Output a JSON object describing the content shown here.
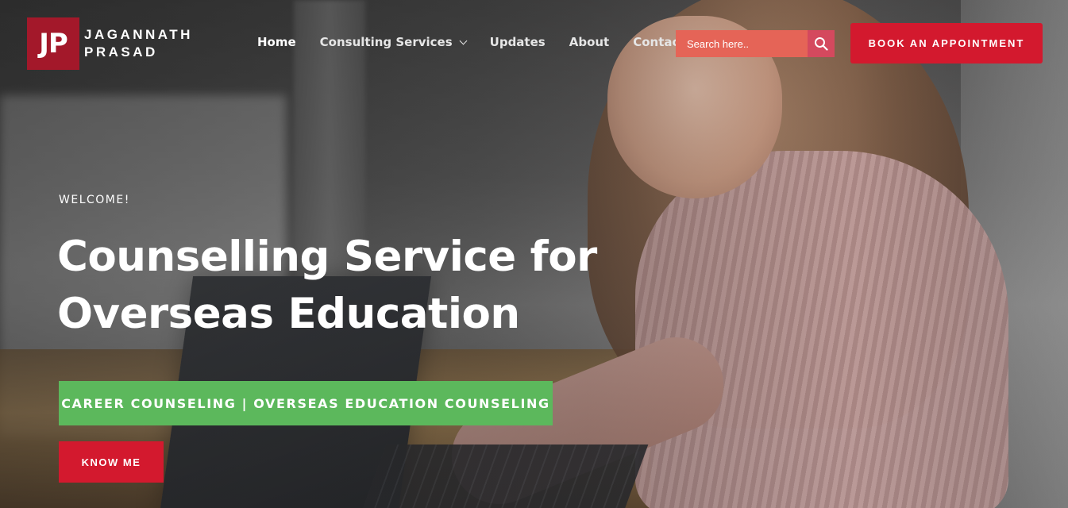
{
  "logo": {
    "mark": "JP",
    "line1": "JAGANNATH",
    "line2": "PRASAD"
  },
  "nav": {
    "items": [
      {
        "label": "Home",
        "active": true
      },
      {
        "label": "Consulting Services",
        "has_dropdown": true
      },
      {
        "label": "Updates"
      },
      {
        "label": "About"
      },
      {
        "label": "Contact"
      }
    ]
  },
  "search": {
    "placeholder": "Search here.."
  },
  "book_button": {
    "label": "BOOK AN APPOINTMENT"
  },
  "hero": {
    "welcome": "WELCOME!",
    "title_line1": "Counselling Service for",
    "title_line2": "Overseas Education",
    "tagline": "CAREER COUNSELING | OVERSEAS EDUCATION COUNSELING",
    "cta_label": "KNOW ME"
  },
  "colors": {
    "brand_red": "#d3192e",
    "logo_red": "#a3182a",
    "search_bg": "#e56457",
    "tagline_green": "#5cb85c"
  },
  "icons": {
    "search": "search-icon",
    "dropdown": "chevron-down-icon"
  }
}
